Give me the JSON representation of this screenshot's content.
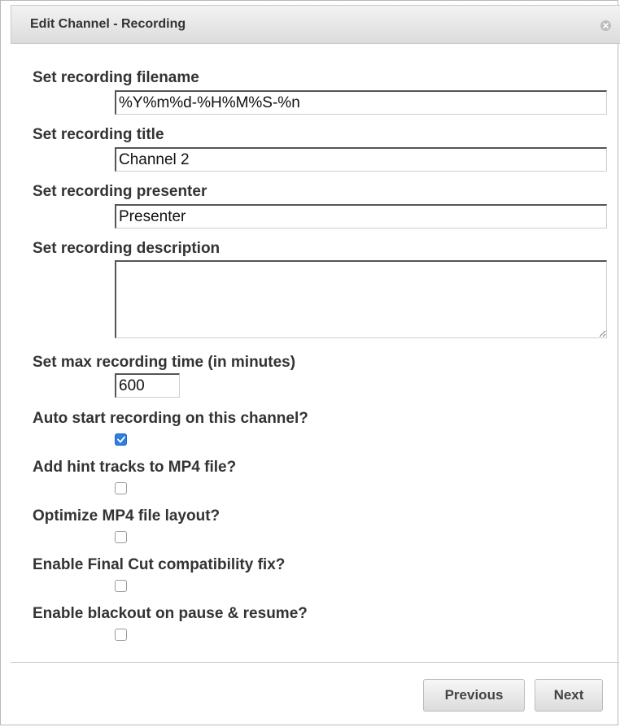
{
  "dialog": {
    "title": "Edit Channel - Recording",
    "close_icon": "close-circle-icon"
  },
  "form": {
    "filename": {
      "label": "Set recording filename",
      "value": "%Y%m%d-%H%M%S-%n"
    },
    "title": {
      "label": "Set recording title",
      "value": "Channel 2"
    },
    "presenter": {
      "label": "Set recording presenter",
      "value": "Presenter"
    },
    "description": {
      "label": "Set recording description",
      "value": ""
    },
    "max_time": {
      "label": "Set max recording time (in minutes)",
      "value": "600"
    },
    "options": [
      {
        "label": "Auto start recording on this channel?",
        "checked": true
      },
      {
        "label": "Add hint tracks to MP4 file?",
        "checked": false
      },
      {
        "label": "Optimize MP4 file layout?",
        "checked": false
      },
      {
        "label": "Enable Final Cut compatibility fix?",
        "checked": false
      },
      {
        "label": "Enable blackout on pause & resume?",
        "checked": false
      }
    ]
  },
  "footer": {
    "previous_label": "Previous",
    "next_label": "Next"
  },
  "colors": {
    "checkbox_checked": "#2e7fe0",
    "text": "#333333"
  }
}
